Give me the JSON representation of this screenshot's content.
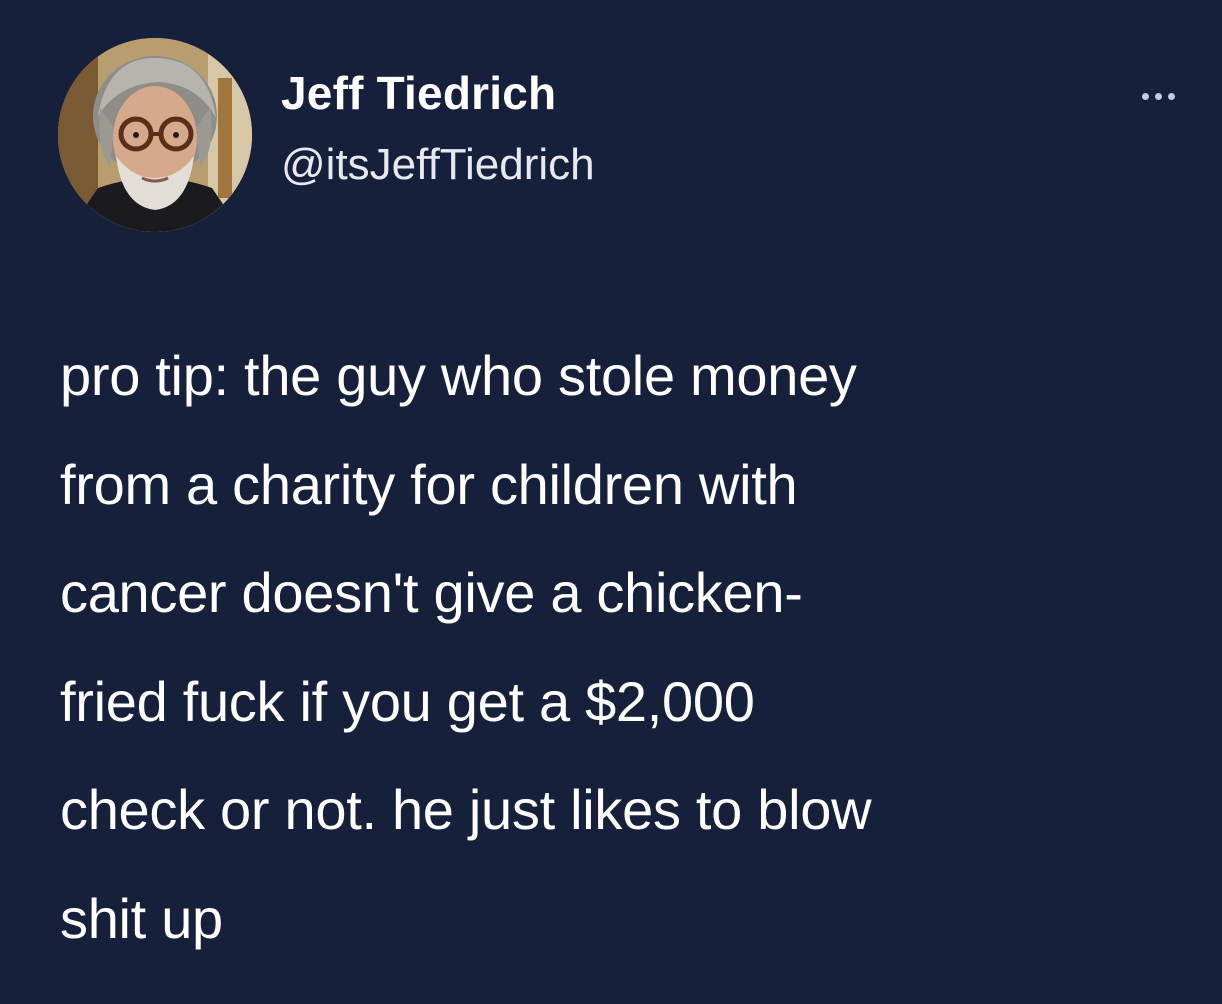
{
  "author": {
    "name": "Jeff Tiedrich",
    "handle": "@itsJeffTiedrich"
  },
  "tweet": {
    "lines": [
      "pro tip: the guy who stole money",
      "from a charity for children with",
      "cancer doesn't give a chicken-",
      "fried fuck if you get a $2,000",
      "check or not. he just likes to blow",
      "shit up"
    ]
  },
  "icons": {
    "more": "more-options-icon",
    "avatar": "profile-photo"
  },
  "colors": {
    "background": "#16203b",
    "text": "#ffffff"
  }
}
